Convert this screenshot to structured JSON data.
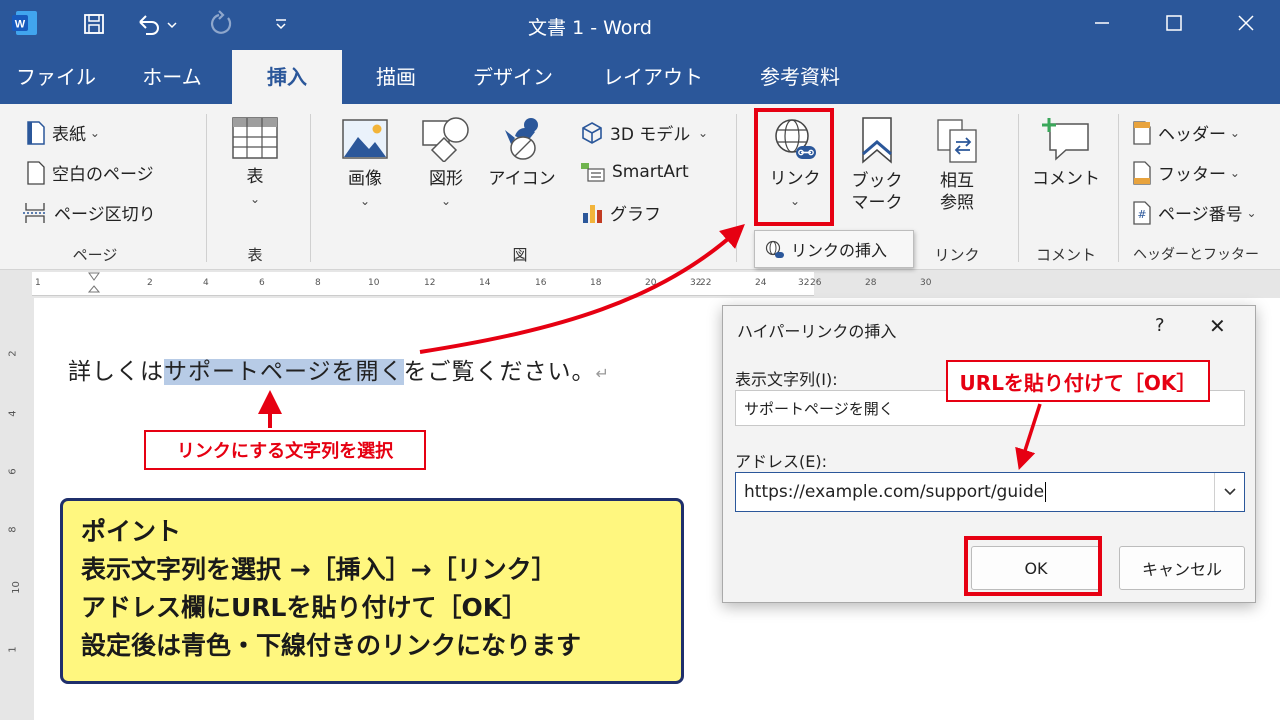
{
  "colors": {
    "brand": "#2b579a",
    "highlight_red": "#e60012",
    "selection": "#b7cbe6",
    "note_yellow": "#fff77f",
    "note_border": "#1f2f6b"
  },
  "titlebar": {
    "title": "文書 1 - Word",
    "icons": [
      "word-logo",
      "save-icon",
      "undo-icon",
      "redo-icon",
      "customize-icon",
      "minimize-icon",
      "maximize-icon",
      "close-icon"
    ]
  },
  "tabs": [
    {
      "label": "ファイル"
    },
    {
      "label": "ホーム"
    },
    {
      "label": "挿入",
      "active": true
    },
    {
      "label": "描画"
    },
    {
      "label": "デザイン"
    },
    {
      "label": "レイアウト"
    },
    {
      "label": "参考資料"
    }
  ],
  "ribbon": {
    "page_group": {
      "cover": "表紙",
      "blank": "空白のページ",
      "break": "ページ区切り",
      "label": "ページ"
    },
    "table_group": {
      "button": "表",
      "label": "表"
    },
    "illust_group": {
      "image": "画像",
      "shapes": "図形",
      "icons": "アイコン",
      "model3d": "3D モデル",
      "smartart": "SmartArt",
      "chart": "グラフ",
      "label": "図"
    },
    "link_group": {
      "link": "リンク",
      "bookmark_1": "ブック",
      "bookmark_2": "マーク",
      "xref_1": "相互",
      "xref_2": "参照",
      "label": "リンク"
    },
    "comment_group": {
      "comment": "コメント",
      "label": "コメント"
    },
    "hf_group": {
      "header": "ヘッダー",
      "footer": "フッター",
      "page_number": "ページ番号",
      "label": "ヘッダーとフッター"
    },
    "tooltip": "リンクの挿入"
  },
  "ruler": {
    "top_ticks": [
      "1",
      "2",
      "4",
      "6",
      "8",
      "10",
      "12",
      "14",
      "16",
      "18",
      "20",
      "22",
      "24",
      "26",
      "28",
      "30",
      "32",
      "32"
    ],
    "left_ticks": [
      "2",
      "4",
      "6",
      "8",
      "10",
      "1"
    ]
  },
  "document": {
    "before": "詳しくは",
    "selected": "サポートページを開く",
    "after": "をご覧ください。",
    "para_mark": "↵"
  },
  "callouts": {
    "select_text": "リンクにする文字列を選択",
    "paste_url": "URLを貼り付けて［OK］"
  },
  "point_box": {
    "lines": [
      "ポイント",
      "表示文字列を選択 →［挿入］→［リンク］",
      "アドレス欄にURLを貼り付けて［OK］",
      "設定後は青色・下線付きのリンクになります"
    ]
  },
  "dialog": {
    "title": "ハイパーリンクの挿入",
    "help": "?",
    "close": "✕",
    "display_label": "表示文字列(I):",
    "display_value": "サポートページを開く",
    "address_label": "アドレス(E):",
    "address_value": "https://example.com/support/guide",
    "ok": "OK",
    "cancel": "キャンセル"
  }
}
